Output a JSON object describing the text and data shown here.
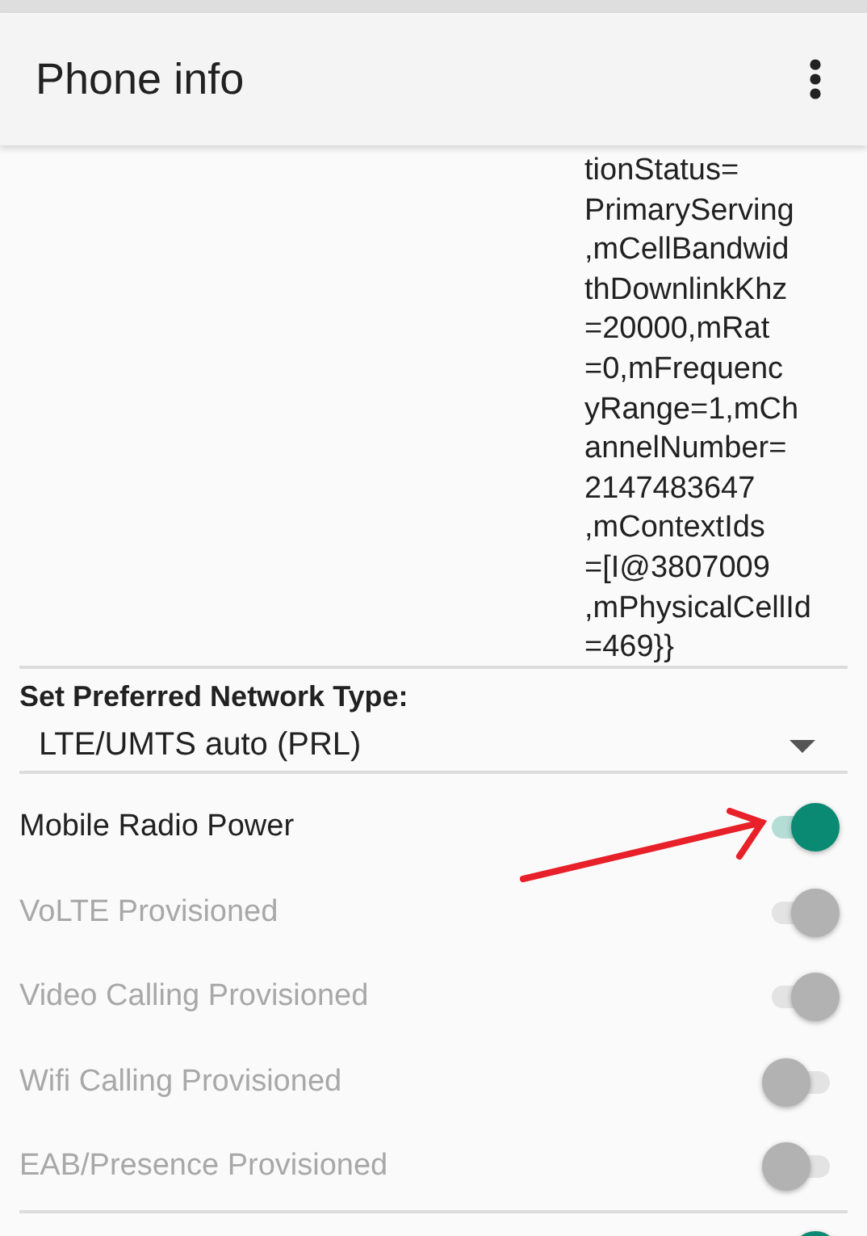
{
  "app_bar": {
    "title": "Phone info"
  },
  "cell_info": {
    "lines": [
      "tionStatus=",
      "PrimaryServing",
      ",mCellBandwid",
      "thDownlinkKhz",
      "=20000,mRat",
      "=0,mFrequenc",
      "yRange=1,mCh",
      "annelNumber=",
      "2147483647",
      ",mContextIds",
      "=[I@3807009",
      ",mPhysicalCellId",
      "=469}}"
    ]
  },
  "network_type": {
    "label": "Set Preferred Network Type:",
    "value": "LTE/UMTS auto (PRL)"
  },
  "switches": [
    {
      "label": "Mobile Radio Power",
      "checked": true,
      "disabled": false
    },
    {
      "label": "VoLTE Provisioned",
      "checked": true,
      "disabled": true
    },
    {
      "label": "Video Calling Provisioned",
      "checked": true,
      "disabled": true
    },
    {
      "label": "Wifi Calling Provisioned",
      "checked": false,
      "disabled": true
    },
    {
      "label": "EAB/Presence Provisioned",
      "checked": false,
      "disabled": true
    }
  ],
  "bottom_switch": {
    "checked": true,
    "disabled": false
  }
}
